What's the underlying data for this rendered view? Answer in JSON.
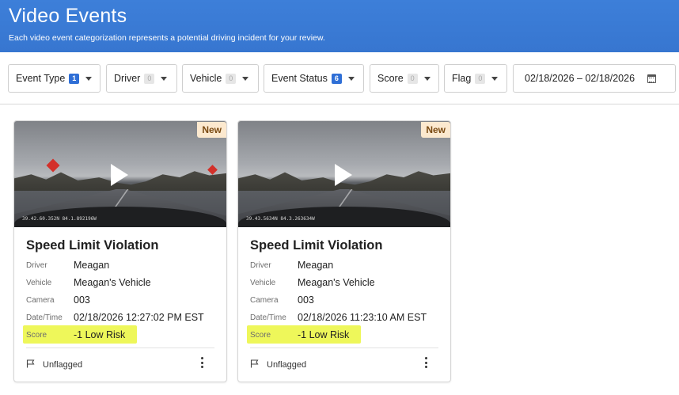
{
  "header": {
    "title": "Video Events",
    "subtitle": "Each video event categorization represents a potential driving incident for your review."
  },
  "filters": {
    "event_type": {
      "label": "Event Type",
      "count": "1"
    },
    "driver": {
      "label": "Driver",
      "count": "0"
    },
    "vehicle": {
      "label": "Vehicle",
      "count": "0"
    },
    "event_status": {
      "label": "Event Status",
      "count": "6"
    },
    "score": {
      "label": "Score",
      "count": "0"
    },
    "flag": {
      "label": "Flag",
      "count": "0"
    },
    "date_range": "02/18/2026 – 02/18/2026"
  },
  "labels": {
    "driver": "Driver",
    "vehicle": "Vehicle",
    "camera": "Camera",
    "datetime": "Date/Time",
    "score": "Score"
  },
  "events": [
    {
      "badge": "New",
      "title": "Speed Limit Violation",
      "coords": "39.42.60.352N 84.1.892196W",
      "driver": "Meagan",
      "vehicle": "Meagan's Vehicle",
      "camera": "003",
      "datetime": "02/18/2026 12:27:02 PM EST",
      "score": "-1 Low Risk",
      "flag_status": "Unflagged"
    },
    {
      "badge": "New",
      "title": "Speed Limit Violation",
      "coords": "39.43.5634N 84.3.263634W",
      "driver": "Meagan",
      "vehicle": "Meagan's Vehicle",
      "camera": "003",
      "datetime": "02/18/2026 11:23:10 AM EST",
      "score": "-1 Low Risk",
      "flag_status": "Unflagged"
    }
  ],
  "colors": {
    "header_bg": "#3a7bd5",
    "active_badge": "#2f6fd6",
    "score_highlight": "#eef75a",
    "new_badge_bg": "#fce9cf"
  }
}
